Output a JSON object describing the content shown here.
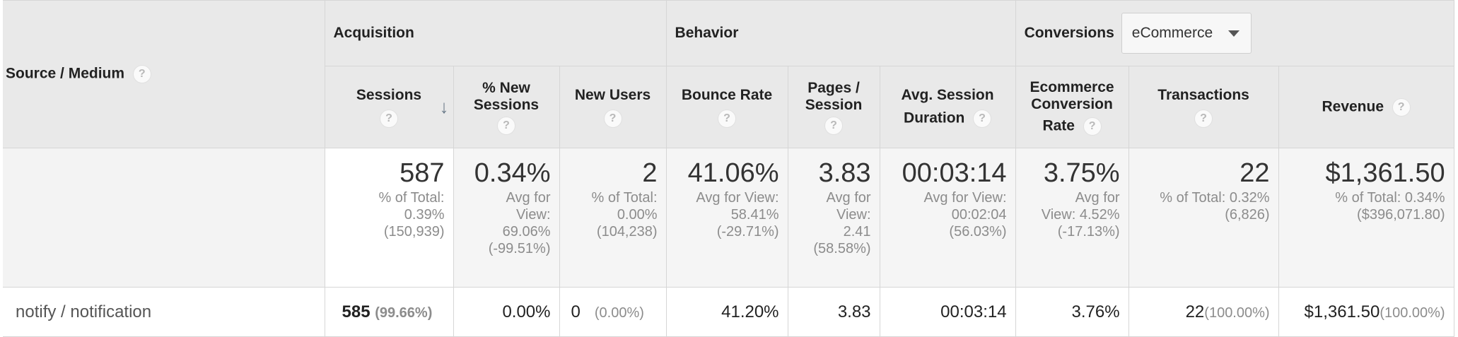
{
  "source_medium": {
    "label": "Source / Medium",
    "help": "?"
  },
  "groups": {
    "acquisition": "Acquisition",
    "behavior": "Behavior",
    "conversions": "Conversions"
  },
  "conversion_select": {
    "value": "eCommerce"
  },
  "columns": {
    "sessions": "Sessions",
    "new_sessions_1": "% New",
    "new_sessions_2": "Sessions",
    "new_users": "New Users",
    "bounce_rate": "Bounce Rate",
    "pages_1": "Pages /",
    "pages_2": "Session",
    "avg_dur_1": "Avg. Session",
    "avg_dur_2": "Duration",
    "ecr_1": "Ecommerce",
    "ecr_2": "Conversion",
    "ecr_3": "Rate",
    "transactions": "Transactions",
    "revenue": "Revenue",
    "help": "?",
    "sort_arrow": "↓"
  },
  "totals": {
    "sessions": {
      "value": "587",
      "l1": "% of Total:",
      "l2": "0.39%",
      "l3": "(150,939)"
    },
    "new_sessions": {
      "value": "0.34%",
      "l1": "Avg for",
      "l2": "View:",
      "l3": "69.06%",
      "l4": "(-99.51%)"
    },
    "new_users": {
      "value": "2",
      "l1": "% of Total:",
      "l2": "0.00%",
      "l3": "(104,238)"
    },
    "bounce_rate": {
      "value": "41.06%",
      "l1": "Avg for View:",
      "l2": "58.41%",
      "l3": "(-29.71%)"
    },
    "pages": {
      "value": "3.83",
      "l1": "Avg for",
      "l2": "View:",
      "l3": "2.41",
      "l4": "(58.58%)"
    },
    "avg_dur": {
      "value": "00:03:14",
      "l1": "Avg for View:",
      "l2": "00:02:04",
      "l3": "(56.03%)"
    },
    "ecr": {
      "value": "3.75%",
      "l1": "Avg for",
      "l2": "View: 4.52%",
      "l3": "(-17.13%)"
    },
    "transactions": {
      "value": "22",
      "l1": "% of Total: 0.32%",
      "l2": "(6,826)"
    },
    "revenue": {
      "value": "$1,361.50",
      "l1": "% of Total: 0.34%",
      "l2": "($396,071.80)"
    }
  },
  "row": {
    "source": "notify / notification",
    "sessions": "585",
    "sessions_pct": "(99.66%)",
    "new_sessions": "0.00%",
    "new_users": "0",
    "new_users_pct": "(0.00%)",
    "bounce_rate": "41.20%",
    "pages": "3.83",
    "avg_dur": "00:03:14",
    "ecr": "3.76%",
    "transactions": "22",
    "transactions_pct": "(100.00%)",
    "revenue": "$1,361.50",
    "revenue_pct": "(100.00%)"
  }
}
